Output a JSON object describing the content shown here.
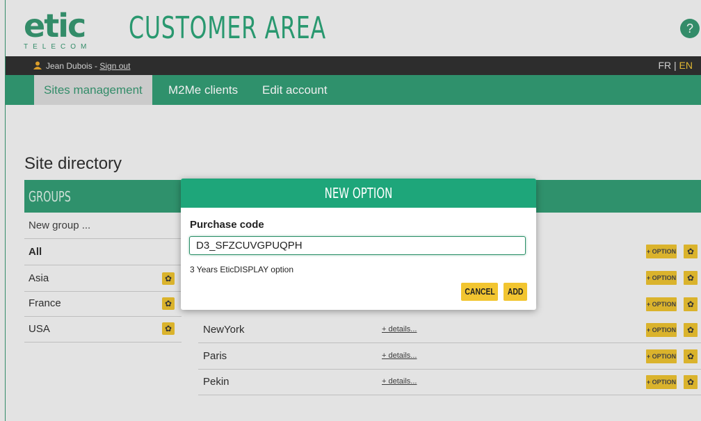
{
  "header": {
    "logo_text": "etic",
    "logo_subtext": "TELECOM",
    "title": "CUSTOMER AREA",
    "help_label": "?"
  },
  "userbar": {
    "user_name": "Jean Dubois",
    "separator": " - ",
    "signout_label": "Sign out",
    "lang_fr": "FR",
    "lang_sep": " | ",
    "lang_en": "EN"
  },
  "nav": {
    "items": [
      {
        "label": "Sites management",
        "active": true
      },
      {
        "label": "M2Me clients",
        "active": false
      },
      {
        "label": "Edit account",
        "active": false
      }
    ]
  },
  "page": {
    "section_title": "Site directory"
  },
  "groups": {
    "title": "GROUPS",
    "new_group": "New group ...",
    "items": [
      "All",
      "Asia",
      "France",
      "USA"
    ]
  },
  "sites": {
    "details_label": "+ details...",
    "option_label": "+ OPTION",
    "rows": [
      "NewYork",
      "Paris",
      "Pekin"
    ]
  },
  "modal": {
    "title": "NEW OPTION",
    "field_label": "Purchase code",
    "field_value": "D3_SFZCUVGPUQPH",
    "hint": "3 Years EticDISPLAY option",
    "cancel_label": "CANCEL",
    "add_label": "ADD"
  },
  "colors": {
    "brand_green": "#25946a",
    "accent_yellow": "#e8bb22",
    "dark_bar": "#232323"
  }
}
